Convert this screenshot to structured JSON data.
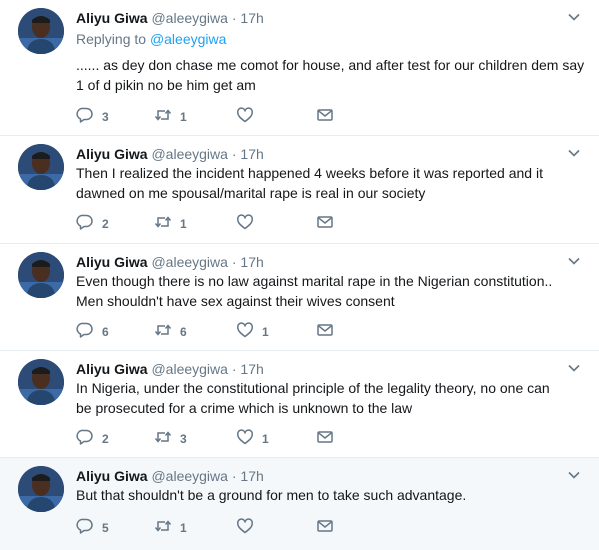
{
  "colors": {
    "text": "#14171a",
    "muted": "#657786",
    "link": "#1da1f2",
    "border": "#e6ecf0",
    "thread_line": "#c4cfd6",
    "highlight_bg": "#f5f8fa"
  },
  "icons": [
    "avatar",
    "chevron-down-icon",
    "reply-icon",
    "retweet-icon",
    "like-icon",
    "message-icon"
  ],
  "tweets": [
    {
      "name": "Aliyu Giwa",
      "handle": "@aleeygiwa",
      "dot": "·",
      "time": "17h",
      "replying_prefix": "Replying to ",
      "replying_to": "@aleeygiwa",
      "lines": [
        "...... as dey don chase me comot for house, and after test for our children dem say",
        "1 of d pikin no be him get am"
      ],
      "replies": "3",
      "retweets": "1",
      "likes": ""
    },
    {
      "name": "Aliyu Giwa",
      "handle": "@aleeygiwa",
      "dot": "·",
      "time": "17h",
      "lines": [
        "Then I realized the incident happened 4 weeks before it was reported and it",
        "dawned on me spousal/marital rape is real in our society"
      ],
      "replies": "2",
      "retweets": "1",
      "likes": ""
    },
    {
      "name": "Aliyu Giwa",
      "handle": "@aleeygiwa",
      "dot": "·",
      "time": "17h",
      "lines": [
        "Even though there is no law against marital rape in the Nigerian constitution..",
        "Men shouldn't have sex against their wives consent"
      ],
      "replies": "6",
      "retweets": "6",
      "likes": "1"
    },
    {
      "name": "Aliyu Giwa",
      "handle": "@aleeygiwa",
      "dot": "·",
      "time": "17h",
      "lines": [
        "In Nigeria, under the constitutional principle of the legality theory, no one can",
        "be prosecuted for a crime which is unknown to the law"
      ],
      "replies": "2",
      "retweets": "3",
      "likes": "1"
    },
    {
      "name": "Aliyu Giwa",
      "handle": "@aleeygiwa",
      "dot": "·",
      "time": "17h",
      "lines": [
        "But that shouldn't be a ground for men to take such advantage."
      ],
      "replies": "5",
      "retweets": "1",
      "likes": ""
    }
  ]
}
